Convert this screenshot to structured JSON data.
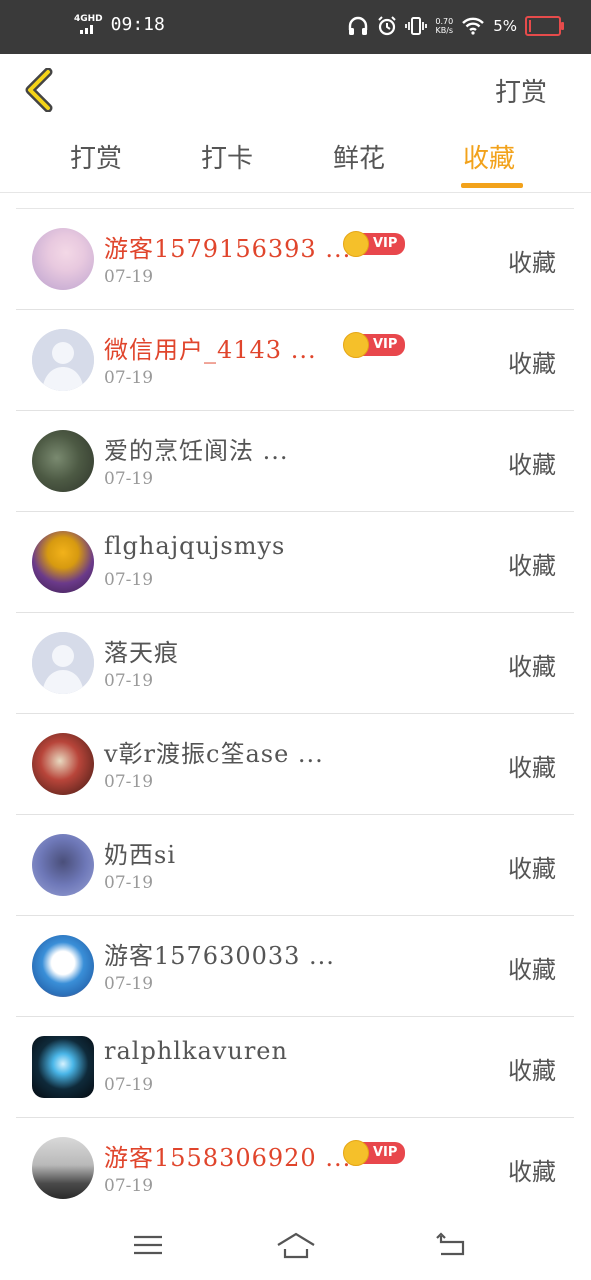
{
  "status_bar": {
    "network": "4GHD",
    "time": "09:18",
    "speed_value": "0.70",
    "speed_unit": "KB/s",
    "battery": "5%"
  },
  "header": {
    "back_icon": "chevron-left-icon",
    "title": "打赏"
  },
  "tabs": [
    {
      "label": "打赏",
      "active": false
    },
    {
      "label": "打卡",
      "active": false
    },
    {
      "label": "鲜花",
      "active": false
    },
    {
      "label": "收藏",
      "active": true
    }
  ],
  "accent_color": "#f2a21b",
  "vip_name_color": "#e0452c",
  "vip_label": "VIP",
  "items": [
    {
      "name": "游客1579156393 ...",
      "date": "07-19",
      "action": "收藏",
      "vip": true
    },
    {
      "name": "微信用户_4143 ...",
      "date": "07-19",
      "action": "收藏",
      "vip": true
    },
    {
      "name": "爱的烹饪阆法 ...",
      "date": "07-19",
      "action": "收藏",
      "vip": false
    },
    {
      "name": "flghajqujsmys",
      "date": "07-19",
      "action": "收藏",
      "vip": false
    },
    {
      "name": "落天痕",
      "date": "07-19",
      "action": "收藏",
      "vip": false
    },
    {
      "name": "v彰r渡振c筌ase ...",
      "date": "07-19",
      "action": "收藏",
      "vip": false
    },
    {
      "name": "奶西si",
      "date": "07-19",
      "action": "收藏",
      "vip": false
    },
    {
      "name": "游客157630033 ...",
      "date": "07-19",
      "action": "收藏",
      "vip": false
    },
    {
      "name": "ralphlkavuren",
      "date": "07-19",
      "action": "收藏",
      "vip": false
    },
    {
      "name": "游客1558306920 ...",
      "date": "07-19",
      "action": "收藏",
      "vip": true
    }
  ],
  "nav": {
    "menu_icon": "menu-icon",
    "home_icon": "home-icon",
    "back_icon": "back-arrow-icon"
  }
}
